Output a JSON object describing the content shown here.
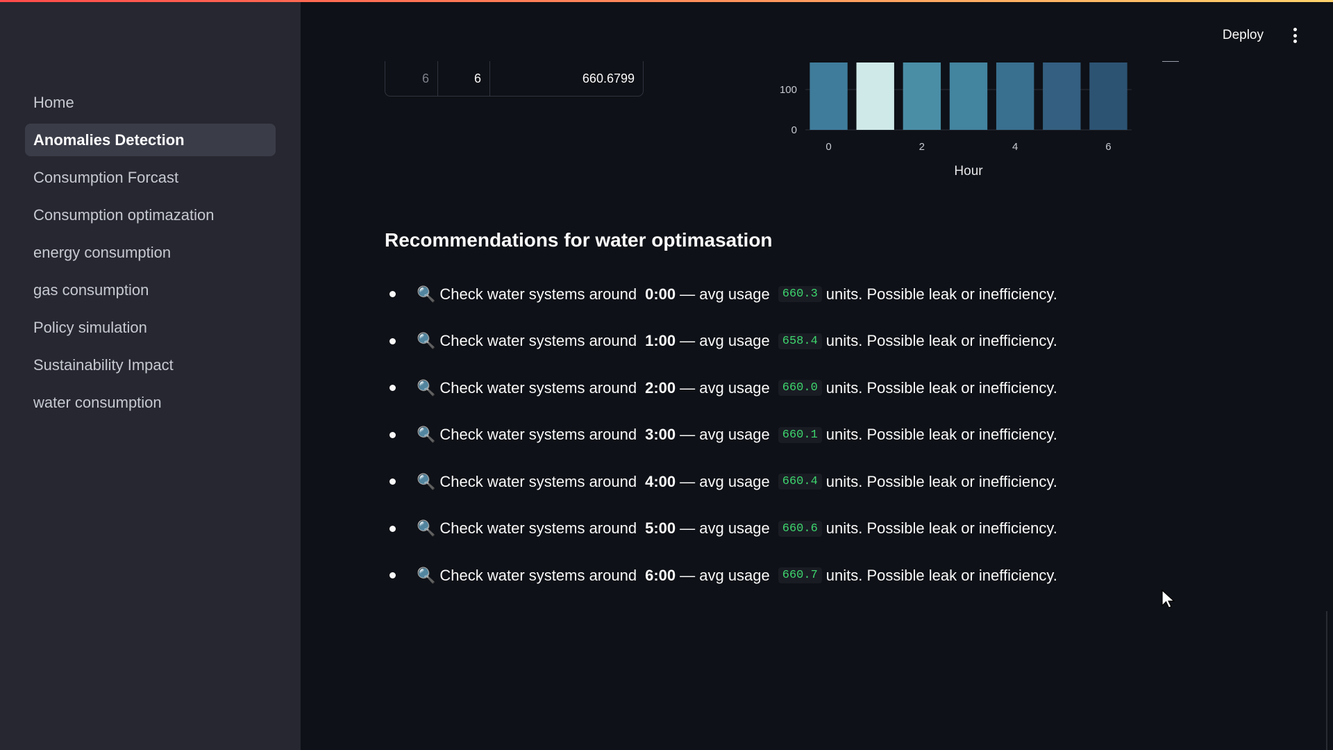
{
  "sidebar": {
    "items": [
      {
        "label": "Home",
        "active": false
      },
      {
        "label": "Anomalies Detection",
        "active": true
      },
      {
        "label": "Consumption Forcast",
        "active": false
      },
      {
        "label": "Consumption optimazation",
        "active": false
      },
      {
        "label": "energy consumption",
        "active": false
      },
      {
        "label": "gas consumption",
        "active": false
      },
      {
        "label": "Policy simulation",
        "active": false
      },
      {
        "label": "Sustainability Impact",
        "active": false
      },
      {
        "label": "water consumption",
        "active": false
      }
    ]
  },
  "header": {
    "deploy_label": "Deploy",
    "menu_icon": "kebab-menu-icon"
  },
  "table_fragment": {
    "index": "6",
    "hour": "6",
    "value": "660.6799"
  },
  "chart_data": {
    "type": "bar",
    "categories": [
      0,
      1,
      2,
      3,
      4,
      5,
      6
    ],
    "values": [
      660.3,
      658.4,
      660.0,
      660.1,
      660.4,
      660.6,
      660.7
    ],
    "bar_colors": [
      "#3f7c9b",
      "#cfe9e8",
      "#4a8ea6",
      "#43849f",
      "#396f8f",
      "#345f80",
      "#2d5373"
    ],
    "xlabel": "Hour",
    "x_ticks": [
      "0",
      "2",
      "4",
      "6"
    ],
    "y_ticks_visible": [
      "0",
      "100"
    ]
  },
  "recommendations": {
    "title": "Recommendations for water optimasation",
    "items": [
      {
        "icon": "🔍",
        "prefix": "Check water systems around",
        "hour": "0:00",
        "mid": "— avg usage",
        "value": "660.3",
        "suffix": "units. Possible leak or inefficiency."
      },
      {
        "icon": "🔍",
        "prefix": "Check water systems around",
        "hour": "1:00",
        "mid": "— avg usage",
        "value": "658.4",
        "suffix": "units. Possible leak or inefficiency."
      },
      {
        "icon": "🔍",
        "prefix": "Check water systems around",
        "hour": "2:00",
        "mid": "— avg usage",
        "value": "660.0",
        "suffix": "units. Possible leak or inefficiency."
      },
      {
        "icon": "🔍",
        "prefix": "Check water systems around",
        "hour": "3:00",
        "mid": "— avg usage",
        "value": "660.1",
        "suffix": "units. Possible leak or inefficiency."
      },
      {
        "icon": "🔍",
        "prefix": "Check water systems around",
        "hour": "4:00",
        "mid": "— avg usage",
        "value": "660.4",
        "suffix": "units. Possible leak or inefficiency."
      },
      {
        "icon": "🔍",
        "prefix": "Check water systems around",
        "hour": "5:00",
        "mid": "— avg usage",
        "value": "660.6",
        "suffix": "units. Possible leak or inefficiency."
      },
      {
        "icon": "🔍",
        "prefix": "Check water systems around",
        "hour": "6:00",
        "mid": "— avg usage",
        "value": "660.7",
        "suffix": "units. Possible leak or inefficiency."
      }
    ]
  }
}
